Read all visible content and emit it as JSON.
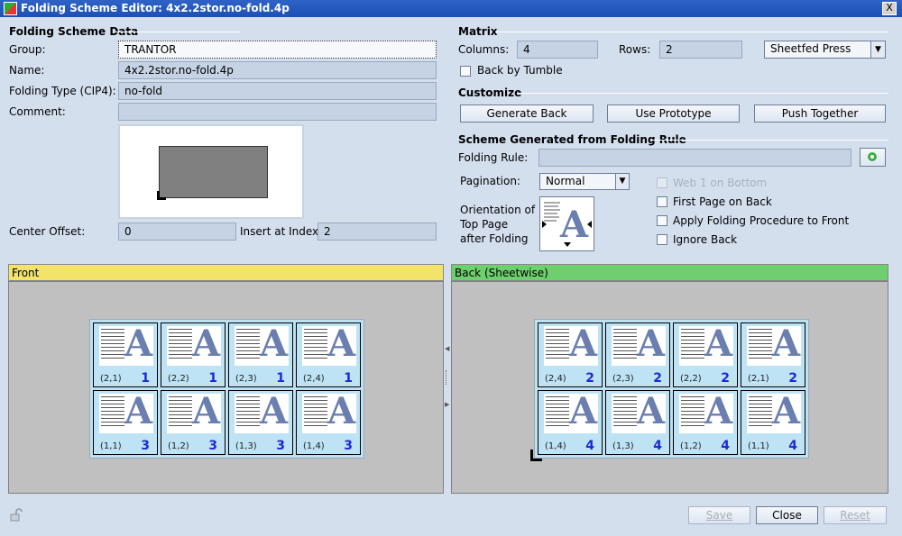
{
  "window": {
    "title": "Folding Scheme Editor: 4x2.2stor.no-fold.4p",
    "close_glyph": "X"
  },
  "scheme_data": {
    "section_title": "Folding Scheme Data",
    "group_label": "Group:",
    "group_value": "TRANTOR",
    "name_label": "Name:",
    "name_value": "4x2.2stor.no-fold.4p",
    "folding_type_label": "Folding Type (CIP4):",
    "folding_type_value": "no-fold",
    "comment_label": "Comment:",
    "comment_value": "",
    "center_offset_label": "Center Offset:",
    "center_offset_value": "0",
    "insert_index_label": "Insert at Index",
    "insert_index_value": "2"
  },
  "matrix": {
    "section_title": "Matrix",
    "columns_label": "Columns:",
    "columns_value": "4",
    "rows_label": "Rows:",
    "rows_value": "2",
    "press_value": "Sheetfed Press",
    "back_by_tumble_label": "Back by Tumble"
  },
  "customize": {
    "section_title": "Customize",
    "generate_back": "Generate Back",
    "use_prototype": "Use Prototype",
    "push_together": "Push Together"
  },
  "scheme_rule": {
    "section_title": "Scheme Generated from Folding Rule",
    "folding_rule_label": "Folding Rule:",
    "folding_rule_value": "",
    "pagination_label": "Pagination:",
    "pagination_value": "Normal",
    "orientation_label_1": "Orientation of",
    "orientation_label_2": "Top Page",
    "orientation_label_3": "after Folding",
    "web1_bottom": "Web 1 on Bottom",
    "first_page_back": "First Page on Back",
    "apply_folding_front": "Apply Folding Procedure to Front",
    "ignore_back": "Ignore Back"
  },
  "front": {
    "header": "Front",
    "header_color": "#f2e46a",
    "cells": [
      {
        "coord": "(2,1)",
        "page": "1"
      },
      {
        "coord": "(2,2)",
        "page": "1"
      },
      {
        "coord": "(2,3)",
        "page": "1"
      },
      {
        "coord": "(2,4)",
        "page": "1"
      },
      {
        "coord": "(1,1)",
        "page": "3"
      },
      {
        "coord": "(1,2)",
        "page": "3"
      },
      {
        "coord": "(1,3)",
        "page": "3"
      },
      {
        "coord": "(1,4)",
        "page": "3"
      }
    ]
  },
  "back": {
    "header": "Back (Sheetwise)",
    "header_color": "#6dcf6d",
    "cells": [
      {
        "coord": "(2,4)",
        "page": "2"
      },
      {
        "coord": "(2,3)",
        "page": "2"
      },
      {
        "coord": "(2,2)",
        "page": "2"
      },
      {
        "coord": "(2,1)",
        "page": "2"
      },
      {
        "coord": "(1,4)",
        "page": "4"
      },
      {
        "coord": "(1,3)",
        "page": "4"
      },
      {
        "coord": "(1,2)",
        "page": "4"
      },
      {
        "coord": "(1,1)",
        "page": "4"
      }
    ]
  },
  "footer": {
    "save": "Save",
    "close": "Close",
    "reset": "Reset"
  },
  "icons": {
    "lock": "lock-icon",
    "folding_rule_picker": "folding-rule-picker-icon",
    "orientation": "orientation-preview-icon"
  }
}
